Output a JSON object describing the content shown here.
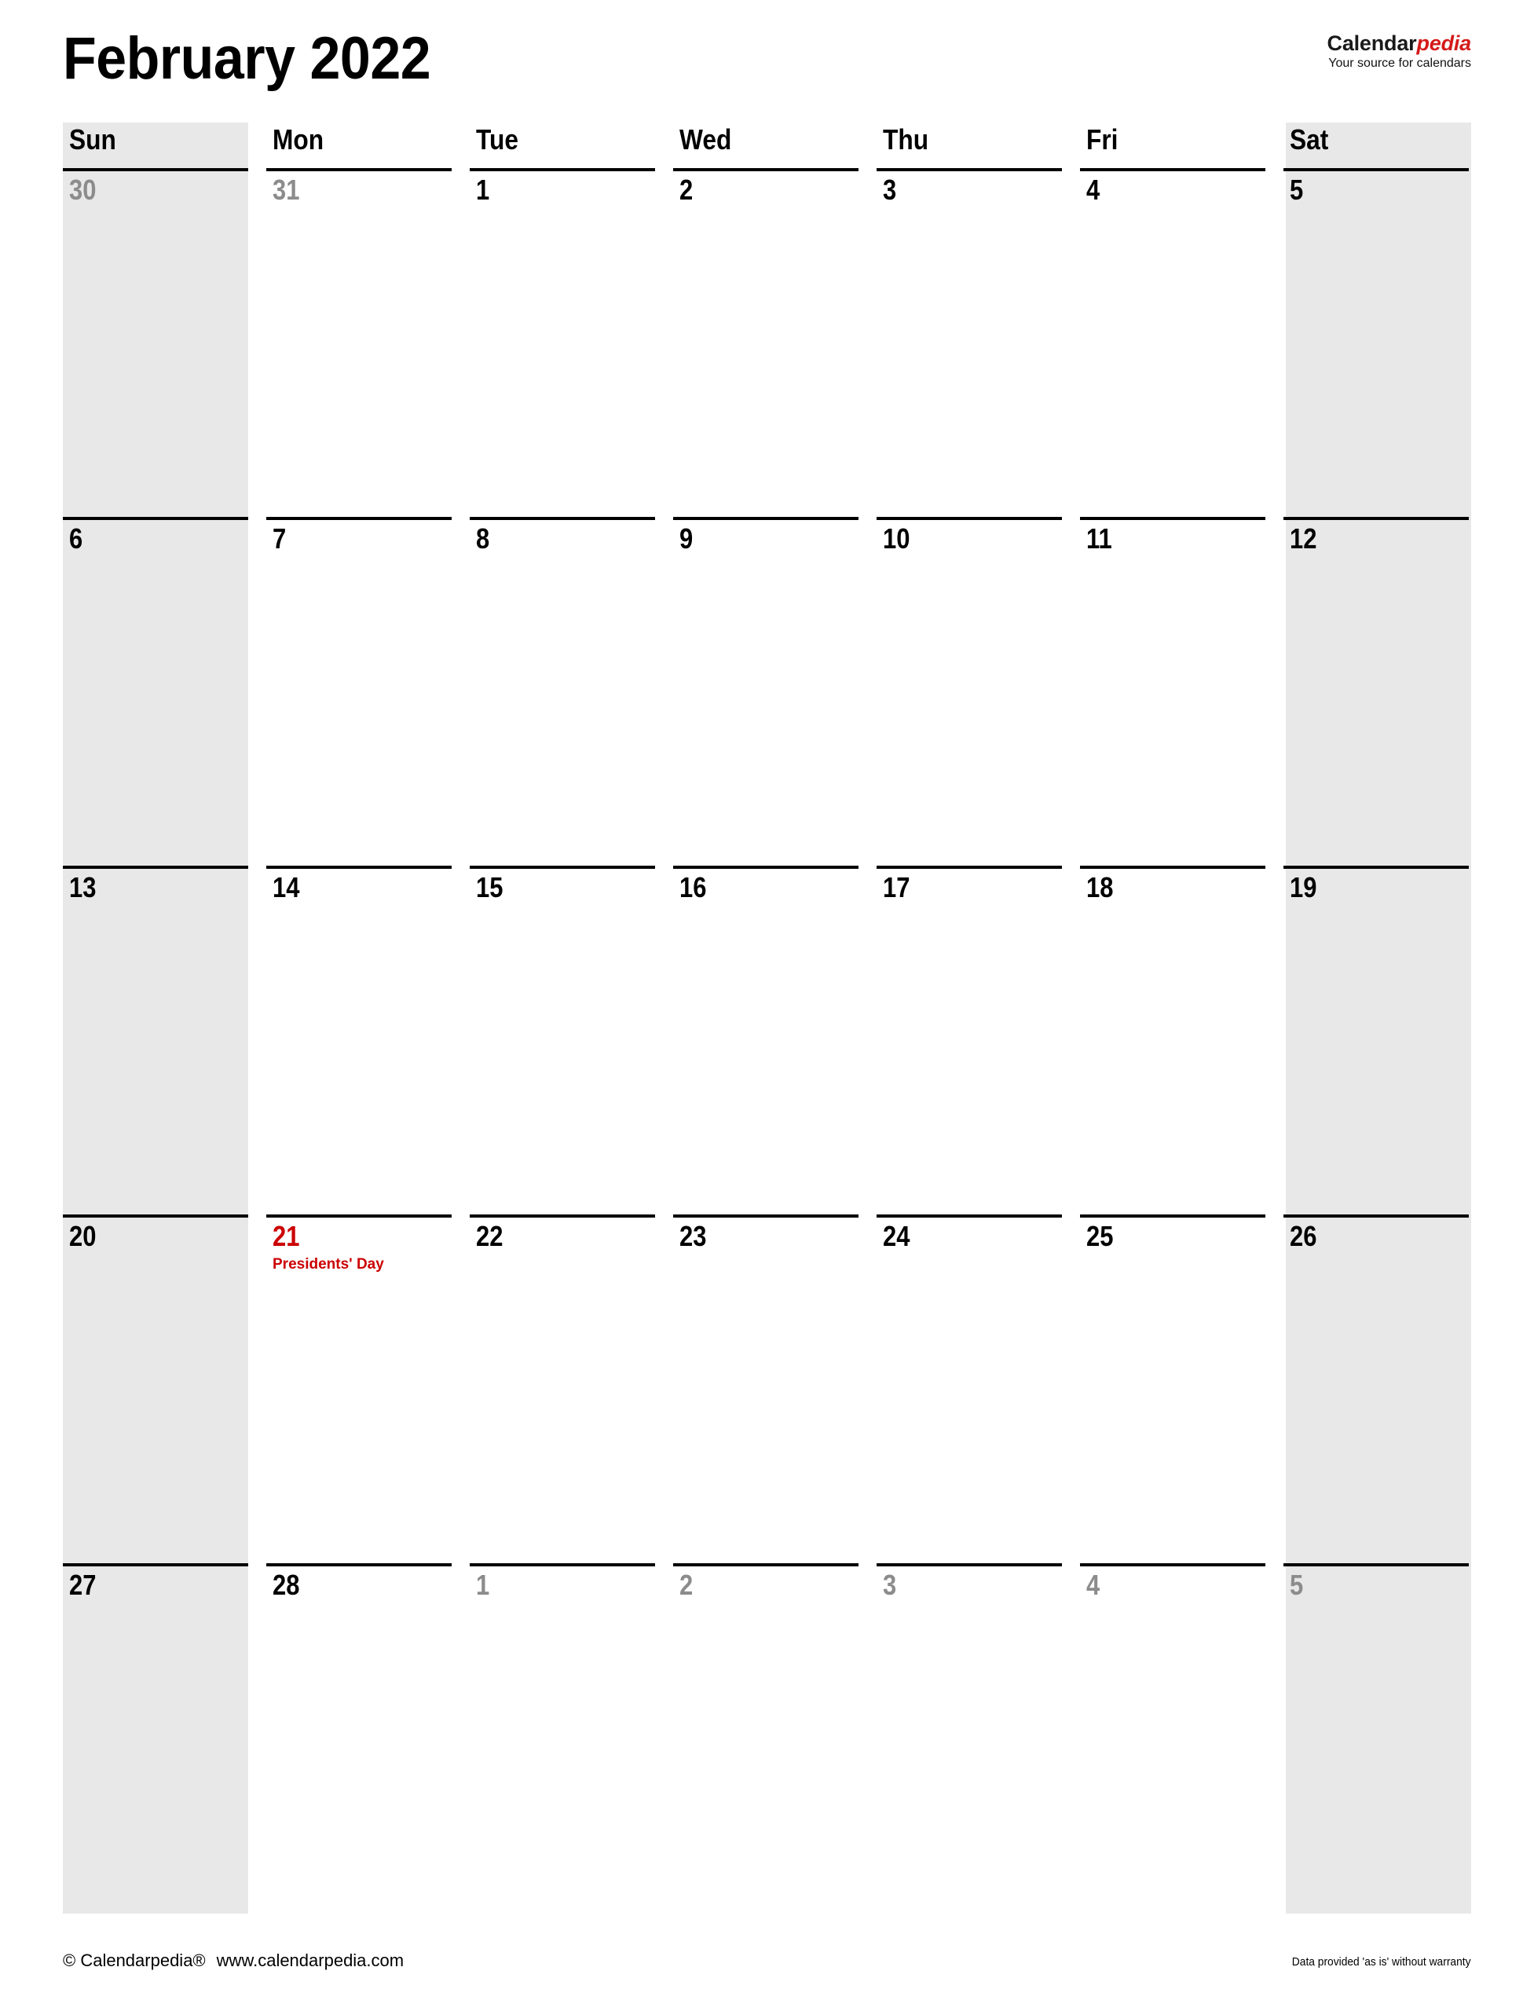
{
  "document": {
    "title": "February 2022",
    "month_name": "February",
    "year": "2022"
  },
  "brand": {
    "name_part1": "Calendar",
    "name_part2": "pedia",
    "tagline": "Your source for calendars",
    "accent_color": "#d41a1a"
  },
  "calendar": {
    "weekday_headers": [
      {
        "label": "Sun",
        "weekend": true
      },
      {
        "label": "Mon",
        "weekend": false
      },
      {
        "label": "Tue",
        "weekend": false
      },
      {
        "label": "Wed",
        "weekend": false
      },
      {
        "label": "Thu",
        "weekend": false
      },
      {
        "label": "Fri",
        "weekend": false
      },
      {
        "label": "Sat",
        "weekend": true
      }
    ],
    "shade_color": "#e8e8e8",
    "other_month_color": "#8c8c8c",
    "holiday_color": "#cc0000",
    "weeks": [
      {
        "days": [
          {
            "num": "30",
            "other_month": true,
            "holiday": false,
            "events": []
          },
          {
            "num": "31",
            "other_month": true,
            "holiday": false,
            "events": []
          },
          {
            "num": "1",
            "other_month": false,
            "holiday": false,
            "events": []
          },
          {
            "num": "2",
            "other_month": false,
            "holiday": false,
            "events": []
          },
          {
            "num": "3",
            "other_month": false,
            "holiday": false,
            "events": []
          },
          {
            "num": "4",
            "other_month": false,
            "holiday": false,
            "events": []
          },
          {
            "num": "5",
            "other_month": false,
            "holiday": false,
            "events": []
          }
        ]
      },
      {
        "days": [
          {
            "num": "6",
            "other_month": false,
            "holiday": false,
            "events": []
          },
          {
            "num": "7",
            "other_month": false,
            "holiday": false,
            "events": []
          },
          {
            "num": "8",
            "other_month": false,
            "holiday": false,
            "events": []
          },
          {
            "num": "9",
            "other_month": false,
            "holiday": false,
            "events": []
          },
          {
            "num": "10",
            "other_month": false,
            "holiday": false,
            "events": []
          },
          {
            "num": "11",
            "other_month": false,
            "holiday": false,
            "events": []
          },
          {
            "num": "12",
            "other_month": false,
            "holiday": false,
            "events": []
          }
        ]
      },
      {
        "days": [
          {
            "num": "13",
            "other_month": false,
            "holiday": false,
            "events": []
          },
          {
            "num": "14",
            "other_month": false,
            "holiday": false,
            "events": []
          },
          {
            "num": "15",
            "other_month": false,
            "holiday": false,
            "events": []
          },
          {
            "num": "16",
            "other_month": false,
            "holiday": false,
            "events": []
          },
          {
            "num": "17",
            "other_month": false,
            "holiday": false,
            "events": []
          },
          {
            "num": "18",
            "other_month": false,
            "holiday": false,
            "events": []
          },
          {
            "num": "19",
            "other_month": false,
            "holiday": false,
            "events": []
          }
        ]
      },
      {
        "days": [
          {
            "num": "20",
            "other_month": false,
            "holiday": false,
            "events": []
          },
          {
            "num": "21",
            "other_month": false,
            "holiday": true,
            "events": [
              "Presidents' Day"
            ]
          },
          {
            "num": "22",
            "other_month": false,
            "holiday": false,
            "events": []
          },
          {
            "num": "23",
            "other_month": false,
            "holiday": false,
            "events": []
          },
          {
            "num": "24",
            "other_month": false,
            "holiday": false,
            "events": []
          },
          {
            "num": "25",
            "other_month": false,
            "holiday": false,
            "events": []
          },
          {
            "num": "26",
            "other_month": false,
            "holiday": false,
            "events": []
          }
        ]
      },
      {
        "days": [
          {
            "num": "27",
            "other_month": false,
            "holiday": false,
            "events": []
          },
          {
            "num": "28",
            "other_month": false,
            "holiday": false,
            "events": []
          },
          {
            "num": "1",
            "other_month": true,
            "holiday": false,
            "events": []
          },
          {
            "num": "2",
            "other_month": true,
            "holiday": false,
            "events": []
          },
          {
            "num": "3",
            "other_month": true,
            "holiday": false,
            "events": []
          },
          {
            "num": "4",
            "other_month": true,
            "holiday": false,
            "events": []
          },
          {
            "num": "5",
            "other_month": true,
            "holiday": false,
            "events": []
          }
        ]
      }
    ]
  },
  "footer": {
    "copyright": "© Calendarpedia®",
    "website": "www.calendarpedia.com",
    "disclaimer": "Data provided 'as is' without warranty"
  }
}
